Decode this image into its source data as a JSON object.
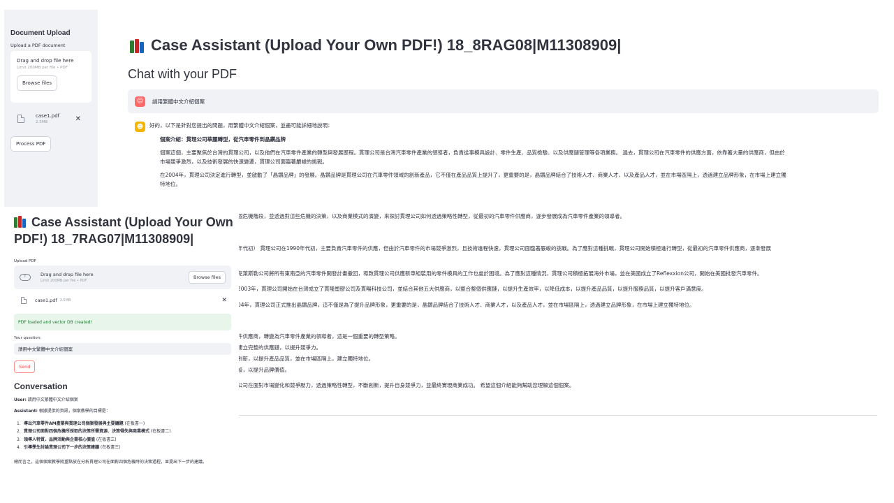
{
  "back_window": {
    "sidebar": {
      "title": "Document Upload",
      "upload_label": "Upload a PDF document",
      "dropzone_title": "Drag and drop file here",
      "dropzone_sub": "Limit 200MB per file • PDF",
      "browse_label": "Browse files",
      "file_name": "case1.pdf",
      "file_size": "2.5MB",
      "remove_glyph": "✕",
      "process_label": "Process PDF"
    },
    "main": {
      "title": "Case Assistant (Upload Your Own PDF!) 18_8RAG08|M11308909|",
      "subtitle": "Chat with your PDF",
      "user_message": "請用繁體中文介紹個案",
      "bot_intro": "好的，以下是針對您提出的問題，用繁體中文介紹個案，並盡可能詳細地說明：",
      "bot_heading": "個案介紹：貫理公司華麗轉型，從汽車零件到晶鑽品牌",
      "bot_p1": "個案這個，主要聚焦於台灣的貫理公司，以及他們在汽車零件產業的轉型與發展歷程。貫理公司是台灣汽車零件產業的領導者，負責從事模具設計、零件生產、品質檢驗、以及供應鏈管理等各項業務。 過去，貫理公司在汽車零件的供應方面，依靠著大量的供應商，但由於",
      "bot_p1b": "市場競爭激烈，以及技術發展的快速變遷，貫理公司面臨著嚴峻的挑戰。",
      "bot_p2": "在2004年，貫理公司決定進行轉型，並啟動了「晶鑽品牌」的發展。晶鑽品牌是貫理公司在汽車零件領域的創新產品，它不僅在產品品質上提升了，更重要的是，晶鑽品牌結合了技術人才、商業人才、以及產品人才，並在市場區隔上，透過建立品牌形象，在市場上建立獨",
      "bot_p2b": "特地位。",
      "cont_lines": [
        "個危機階段，並透過對這些危機的決策，以及商業模式的演變，來探討貫理公司如何透過策略性轉型，從最初的汽車零件供應商，逐步發展成為汽車零件產業的領導者。",
        "年代初）  貫理公司在1990年代初，主要負責汽車零件的供應，但由於汽車零件的市場競爭激烈，且技術進程快速，貫理公司面臨著嚴峻的挑戰。為了應對這種挑戰，貫理公司開始積極進行轉型，從最初的汽車零件供應商，逐漸發展",
        "克萊斯勒公司將所有東南亞的汽車零件開發計畫撤回，導致貫理公司供應新車組裝用的零件模具的工作也處於困境。為了應對這種情況，貫理公司積極拓展海外市場，並在美國成立了Reflexxion公司，開始在美國批發汽車零件。",
        "2003年，貫理公司開始在台灣成立了貫隆塑膠公司及貫暘科技公司，並結合其他五大供應商，以整合整個供應鏈，以提升生產效率，以降低成本，以提升產品品質，以提升服務品質，以提升客戶滿意度。",
        "04年，貫理公司正式推出晶鑽品牌，這不僅是為了提升品牌形象，更重要的是，晶鑽品牌結合了技術人才、商業人才，以及產品人才，並在市場區隔上，透過建立品牌形象，在市場上建立獨特地位。",
        "件供應商，轉變為汽車零件產業的領導者，這是一個重要的轉型策略。",
        "建立完整的供應鏈，以提升競爭力。",
        "創新，以提升產品品質，並在市場區隔上，建立獨特地位。",
        "設，以提升品牌價值。",
        "公司在面對市場變化和競爭壓力，透過策略性轉型，不斷創新，提升自身競爭力，並最終實現商業成功。 希望這個介紹能夠幫助您理解這個個案。"
      ]
    }
  },
  "front_window": {
    "title": "Case Assistant (Upload Your Own PDF!) 18_7RAG07|M11308909|",
    "upload_label": "Upload PDF",
    "dropzone_title": "Drag and drop file here",
    "dropzone_sub": "Limit 200MB per file • PDF",
    "browse_label": "Browse files",
    "file_name": "case1.pdf",
    "file_size": "2.5MB",
    "remove_glyph": "✕",
    "success_message": "PDF loaded and vector DB created!",
    "question_label": "Your question:",
    "question_value": "請用中文繁體中文介紹個案",
    "send_label": "Send",
    "conversation_title": "Conversation",
    "user_prefix": "User:",
    "user_text": "請用中文繁體中文介紹個案",
    "assistant_prefix": "Assistant:",
    "assistant_text": "根據提供的資訊，個案教學的目標是：",
    "goals": [
      {
        "num": "1.",
        "bold": "導出汽車零件AM產業與貫理公司個案發展與主要議題",
        "note": " (在板書一)"
      },
      {
        "num": "2.",
        "bold": "貫理公司面對四個危機所採取的決策所需資源、決策得失與商業模式",
        "note": " (在板書二)"
      },
      {
        "num": "3.",
        "bold": "領導人特質、品牌活動與企業核心價值",
        "note": " (在板書三)"
      },
      {
        "num": "4.",
        "bold": "引導學生討論貫理公司下一步的決策建議",
        "note": " (在板書三)"
      }
    ],
    "summary": "總而言之，這個個案教學將重點放在分析貫理公司在面對四個危機時的決策過程，並提出下一步的建議。"
  },
  "colors": {
    "sidebar_bg": "#f0f2f6",
    "user_avatar": "#ff6b6b",
    "bot_avatar": "#f4b400",
    "success_bg": "#e8f5ea",
    "send_accent": "#ff4b4b"
  }
}
